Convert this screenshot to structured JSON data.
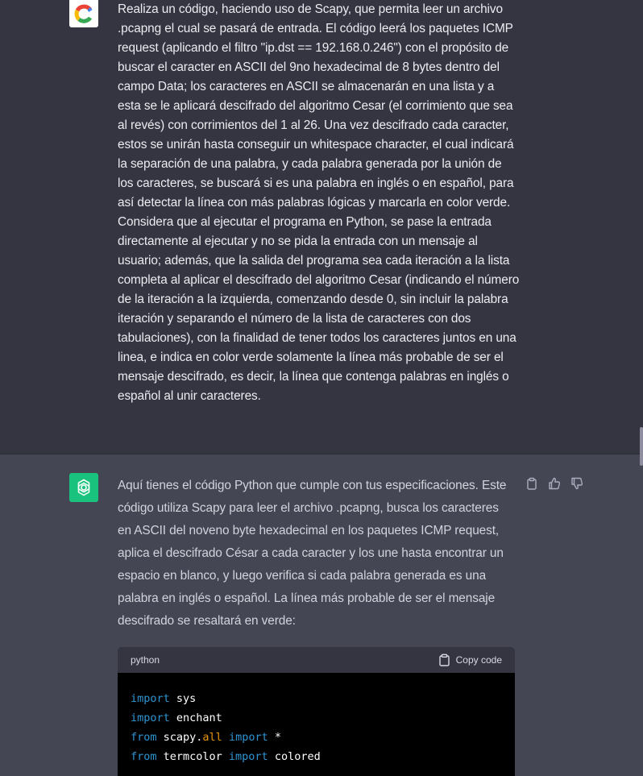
{
  "user_message": {
    "avatar_icon": "colored-c-logo",
    "text": "Realiza un código, haciendo uso de Scapy, que permita leer un archivo .pcapng el cual se pasará de entrada. El código leerá los paquetes ICMP request (aplicando el filtro \"ip.dst == 192.168.0.246\") con el propósito de buscar el caracter en ASCII del 9no hexadecimal de 8 bytes dentro del campo Data; los caracteres en ASCII se almacenarán en una lista y a esta se le aplicará descifrado del algoritmo Cesar (el corrimiento que sea al revés) con corrimientos del 1 al 26. Una vez descifrado cada caracter, estos se unirán hasta conseguir un whitespace character, el cual indicará la separación de una palabra, y cada palabra generada por la unión de los caracteres, se buscará si es una palabra en inglés o en español, para así detectar la línea con más palabras lógicas y marcarla en color verde. Considera que al ejecutar el programa en Python, se pase la entrada directamente al ejecutar y no se pida la entrada con un mensaje al usuario; además, que la salida del programa sea cada iteración a la lista completa al aplicar el descifrado del algoritmo Cesar (indicando el número de la iteración a la izquierda, comenzando desde 0, sin incluir la palabra iteración y separando el número de la lista de caracteres con dos tabulaciones), con la finalidad de tener todos los caracteres juntos en una linea, e indica en color verde solamente la línea más probable de ser el mensaje descifrado, es decir, la línea que contenga palabras en inglés o español al unir caracteres."
  },
  "assistant_message": {
    "avatar_icon": "openai-logo",
    "text": "Aquí tienes el código Python que cumple con tus especificaciones. Este código utiliza Scapy para leer el archivo .pcapng, busca los caracteres en ASCII del noveno byte hexadecimal en los paquetes ICMP request, aplica el descifrado César a cada caracter y los une hasta encontrar un espacio en blanco, y luego verifica si cada palabra generada es una palabra en inglés o español. La línea más probable de ser el mensaje descifrado se resaltará en verde:",
    "actions": [
      "copy-icon",
      "thumbs-up-icon",
      "thumbs-down-icon"
    ]
  },
  "code_block": {
    "language": "python",
    "copy_label": "Copy code",
    "lines": [
      [
        {
          "t": "import",
          "c": "kw"
        },
        {
          "t": " sys",
          "c": "op"
        }
      ],
      [
        {
          "t": "import",
          "c": "kw"
        },
        {
          "t": " enchant",
          "c": "op"
        }
      ],
      [
        {
          "t": "from",
          "c": "kw"
        },
        {
          "t": " scapy.",
          "c": "op"
        },
        {
          "t": "all",
          "c": "mod"
        },
        {
          "t": " ",
          "c": "op"
        },
        {
          "t": "import",
          "c": "kw"
        },
        {
          "t": " *",
          "c": "op"
        }
      ],
      [
        {
          "t": "from",
          "c": "kw"
        },
        {
          "t": " termcolor ",
          "c": "op"
        },
        {
          "t": "import",
          "c": "kw"
        },
        {
          "t": " colored",
          "c": "op"
        }
      ]
    ]
  },
  "colors": {
    "user_bg": "#343541",
    "assistant_bg": "#444654",
    "gpt_avatar": "#19c37d",
    "code_bg": "#000000",
    "keyword": "#2e95d3",
    "module": "#e9950c"
  }
}
